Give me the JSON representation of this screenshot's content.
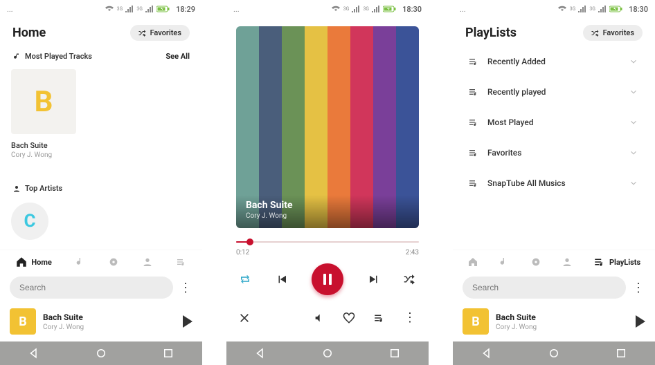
{
  "status": {
    "dots": "...",
    "times": [
      "18:29",
      "18:30",
      "18:30"
    ],
    "net": "3G"
  },
  "chip": {
    "label": "Favorites"
  },
  "home": {
    "title": "Home",
    "section_most_played": "Most Played Tracks",
    "see_all": "See All",
    "track": {
      "title": "Bach Suite",
      "artist": "Cory J. Wong",
      "letter": "B"
    },
    "section_top_artists": "Top Artists",
    "artist_letter": "C"
  },
  "nav": {
    "home": "Home",
    "playlists": "PlayLists"
  },
  "search": {
    "placeholder": "Search"
  },
  "mini": {
    "title": "Bach Suite",
    "artist": "Cory J. Wong",
    "letter": "B"
  },
  "player": {
    "title": "Bach Suite",
    "artist": "Cory J. Wong",
    "elapsed": "0:12",
    "duration": "2:43",
    "progress": 0.075,
    "stripes": [
      "#6fa197",
      "#4a5e7b",
      "#6b9257",
      "#e5c144",
      "#ea7a3b",
      "#d1365b",
      "#7a3f99",
      "#3b5398"
    ]
  },
  "playlists": {
    "title": "PlayLists",
    "items": [
      "Recently Added",
      "Recently played",
      "Most Played",
      "Favorites",
      "SnapTube All Musics"
    ]
  }
}
